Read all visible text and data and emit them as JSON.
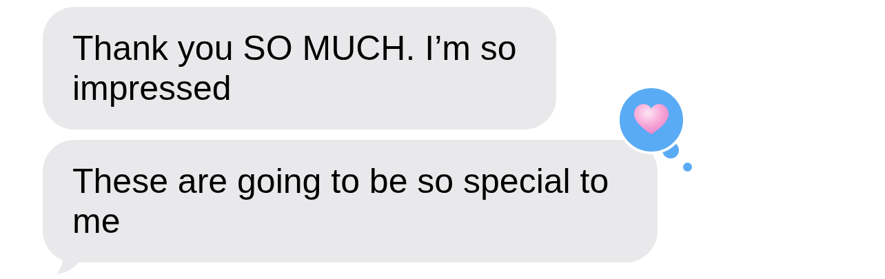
{
  "messages": [
    {
      "text": "Thank you SO MUCH. I’m so impressed",
      "tail": false,
      "hearted": false
    },
    {
      "text": "These are going to be so special to me",
      "tail": true,
      "hearted": true
    }
  ]
}
